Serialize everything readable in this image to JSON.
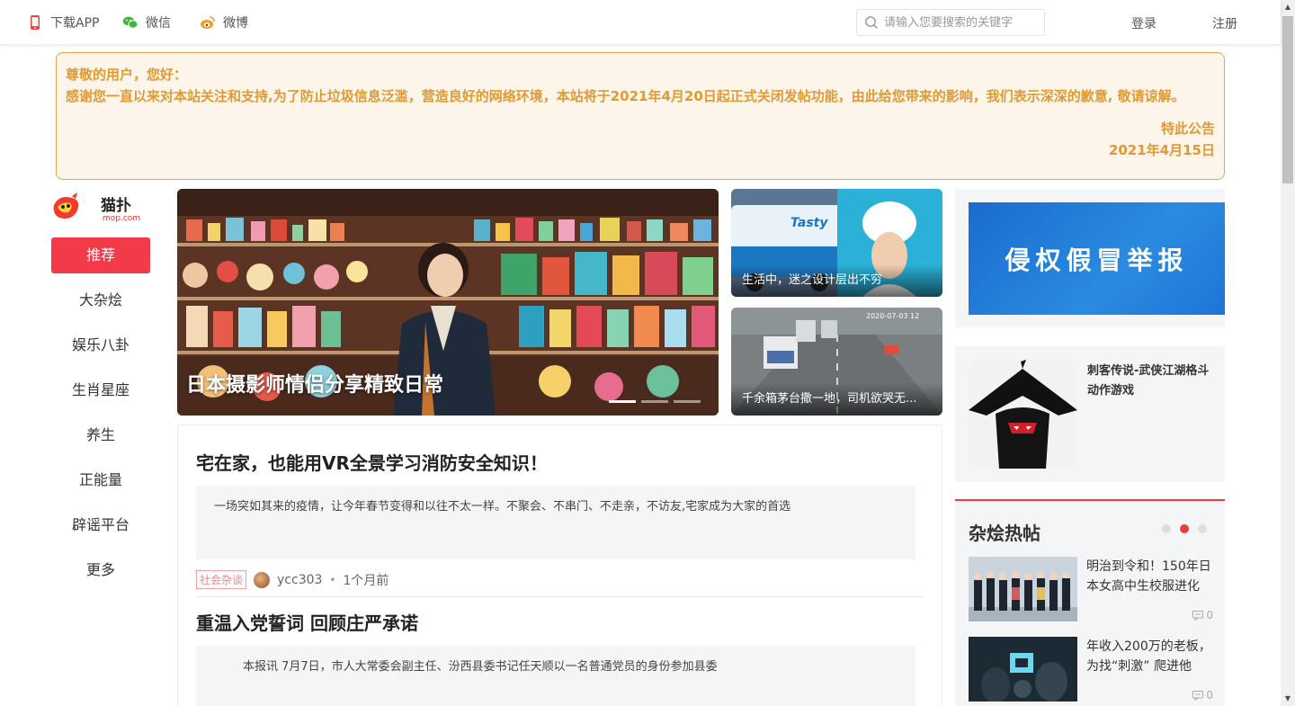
{
  "topbar": {
    "download_app": "下载APP",
    "wechat": "微信",
    "weibo": "微博",
    "search_placeholder": "请输入您要搜索的关键字",
    "login": "登录",
    "register": "注册"
  },
  "notice": {
    "greeting": "尊敬的用户，您好：",
    "body": "感谢您一直以来对本站关注和支持,为了防止垃圾信息泛滥，营造良好的网络环境，本站将于2021年4月20日起正式关闭发帖功能，由此给您带来的影响，我们表示深深的歉意, 敬请谅解。",
    "sign": "特此公告",
    "date": "2021年4月15日"
  },
  "logo": {
    "icon": "mop-logo",
    "text": "猫扑",
    "domain": "mop.com"
  },
  "nav": {
    "items": [
      "推荐",
      "大杂烩",
      "娱乐八卦",
      "生肖星座",
      "养生",
      "正能量",
      "辟谣平台",
      "更多"
    ]
  },
  "carousel": {
    "caption": "日本摄影师情侣分享精致日常",
    "slide_count": 3,
    "active_slide": 1
  },
  "side_cards": [
    {
      "caption": "生活中，迷之设计层出不穷",
      "truck_text": "Tasty"
    },
    {
      "caption": "千余箱茅台撒一地，司机欲哭无...",
      "stamp": "2020-07-03 12"
    }
  ],
  "articles": [
    {
      "title": "宅在家，也能用VR全景学习消防安全知识！",
      "summary": "一场突如其来的疫情，让今年春节变得和以往不太一样。不聚会、不串门、不走亲，不访友,宅家成为大家的首选",
      "tag": "社会杂谈",
      "author": "ycc303",
      "time": "1个月前"
    },
    {
      "title": "重温入党誓词 回顾庄严承诺",
      "summary": "本报讯 7月7日，市人大常委会副主任、汾西县委书记任天顺以一名普通党员的身份参加县委"
    }
  ],
  "right": {
    "ad_banner": "侵权假冒举报",
    "game_title": "刺客传说-武侠江湖格斗动作游戏",
    "hot_title": "杂烩热帖",
    "hot_page": 2,
    "hot_items": [
      {
        "text": "明治到令和！150年日本女高中生校服进化",
        "comments": "0"
      },
      {
        "text": "年收入200万的老板，为找“刺激” 爬进他",
        "comments": "0"
      }
    ]
  },
  "colors": {
    "accent": "#f33a48",
    "notice": "#e09a34",
    "notice_bg": "#fdf4ea"
  }
}
